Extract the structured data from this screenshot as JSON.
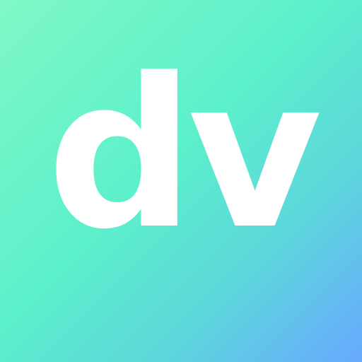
{
  "logo": {
    "text": "dv",
    "text_color": "#ffffff",
    "gradient": [
      "#7ff8c6",
      "#5cf0cb",
      "#5dd6dc",
      "#68a9ff"
    ]
  }
}
